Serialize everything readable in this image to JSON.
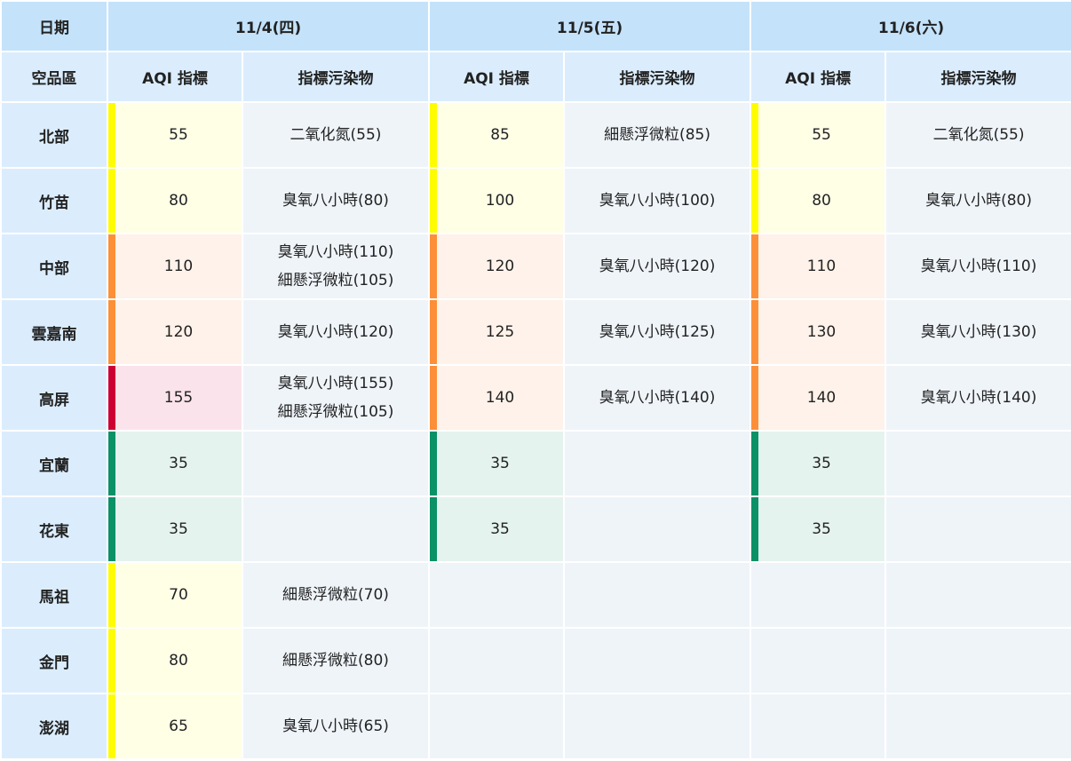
{
  "header": {
    "date_label": "日期",
    "region_label": "空品區",
    "aqi_label": "AQI 指標",
    "pollutant_label": "指標污染物",
    "days": [
      "11/4(四)",
      "11/5(五)",
      "11/6(六)"
    ]
  },
  "rows": [
    {
      "region": "北部",
      "cells": [
        {
          "aqi": "55",
          "level": "moderate",
          "pollutants": [
            "二氧化氮(55)"
          ]
        },
        {
          "aqi": "85",
          "level": "moderate",
          "pollutants": [
            "細懸浮微粒(85)"
          ]
        },
        {
          "aqi": "55",
          "level": "moderate",
          "pollutants": [
            "二氧化氮(55)"
          ]
        }
      ]
    },
    {
      "region": "竹苗",
      "cells": [
        {
          "aqi": "80",
          "level": "moderate",
          "pollutants": [
            "臭氧八小時(80)"
          ]
        },
        {
          "aqi": "100",
          "level": "moderate",
          "pollutants": [
            "臭氧八小時(100)"
          ]
        },
        {
          "aqi": "80",
          "level": "moderate",
          "pollutants": [
            "臭氧八小時(80)"
          ]
        }
      ]
    },
    {
      "region": "中部",
      "cells": [
        {
          "aqi": "110",
          "level": "sensitive",
          "pollutants": [
            "臭氧八小時(110)",
            "細懸浮微粒(105)"
          ]
        },
        {
          "aqi": "120",
          "level": "sensitive",
          "pollutants": [
            "臭氧八小時(120)"
          ]
        },
        {
          "aqi": "110",
          "level": "sensitive",
          "pollutants": [
            "臭氧八小時(110)"
          ]
        }
      ]
    },
    {
      "region": "雲嘉南",
      "cells": [
        {
          "aqi": "120",
          "level": "sensitive",
          "pollutants": [
            "臭氧八小時(120)"
          ]
        },
        {
          "aqi": "125",
          "level": "sensitive",
          "pollutants": [
            "臭氧八小時(125)"
          ]
        },
        {
          "aqi": "130",
          "level": "sensitive",
          "pollutants": [
            "臭氧八小時(130)"
          ]
        }
      ]
    },
    {
      "region": "高屏",
      "cells": [
        {
          "aqi": "155",
          "level": "unhealthy",
          "pollutants": [
            "臭氧八小時(155)",
            "細懸浮微粒(105)"
          ]
        },
        {
          "aqi": "140",
          "level": "sensitive",
          "pollutants": [
            "臭氧八小時(140)"
          ]
        },
        {
          "aqi": "140",
          "level": "sensitive",
          "pollutants": [
            "臭氧八小時(140)"
          ]
        }
      ]
    },
    {
      "region": "宜蘭",
      "cells": [
        {
          "aqi": "35",
          "level": "good",
          "pollutants": []
        },
        {
          "aqi": "35",
          "level": "good",
          "pollutants": []
        },
        {
          "aqi": "35",
          "level": "good",
          "pollutants": []
        }
      ]
    },
    {
      "region": "花東",
      "cells": [
        {
          "aqi": "35",
          "level": "good",
          "pollutants": []
        },
        {
          "aqi": "35",
          "level": "good",
          "pollutants": []
        },
        {
          "aqi": "35",
          "level": "good",
          "pollutants": []
        }
      ]
    },
    {
      "region": "馬祖",
      "cells": [
        {
          "aqi": "70",
          "level": "moderate",
          "pollutants": [
            "細懸浮微粒(70)"
          ]
        },
        null,
        null
      ]
    },
    {
      "region": "金門",
      "cells": [
        {
          "aqi": "80",
          "level": "moderate",
          "pollutants": [
            "細懸浮微粒(80)"
          ]
        },
        null,
        null
      ]
    },
    {
      "region": "澎湖",
      "cells": [
        {
          "aqi": "65",
          "level": "moderate",
          "pollutants": [
            "臭氧八小時(65)"
          ]
        },
        null,
        null
      ]
    }
  ],
  "level_colors": {
    "good": "#0a9166",
    "moderate": "#fffc00",
    "sensitive": "#fd8f38",
    "unhealthy": "#cc0033"
  }
}
